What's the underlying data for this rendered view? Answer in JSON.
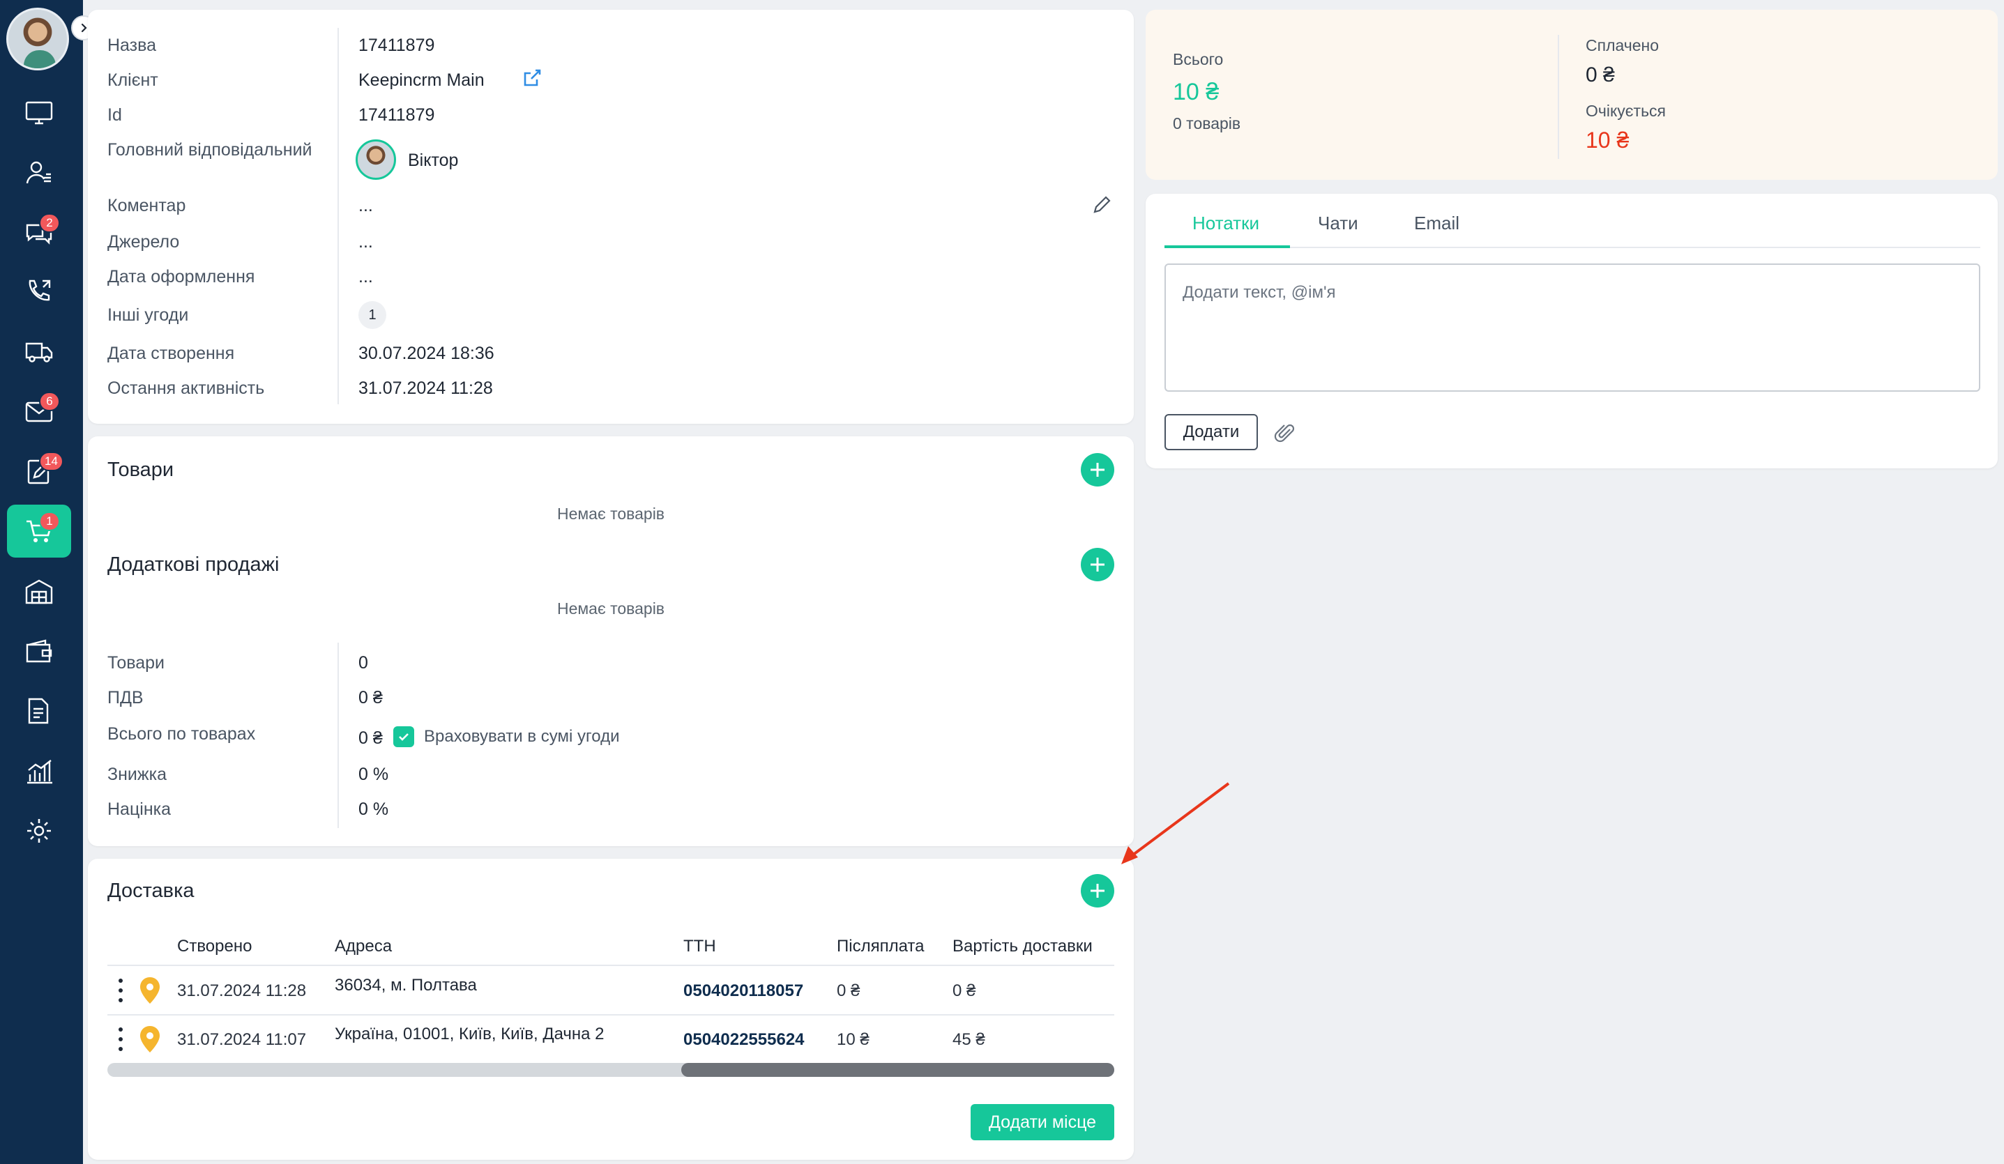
{
  "sidebar": {
    "badges": {
      "chats": "2",
      "mail": "6",
      "tasks": "14",
      "orders": "1"
    }
  },
  "info": {
    "rows": [
      {
        "label": "Назва",
        "value": "17411879"
      },
      {
        "label": "Клієнт",
        "value": "Keepincrm Main"
      },
      {
        "label": "Id",
        "value": "17411879"
      },
      {
        "label": "Головний відповідальний",
        "value": "Віктор"
      },
      {
        "label": "Коментар",
        "value": "..."
      },
      {
        "label": "Джерело",
        "value": "..."
      },
      {
        "label": "Дата оформлення",
        "value": "..."
      },
      {
        "label": "Інші угоди",
        "value": "1"
      },
      {
        "label": "Дата створення",
        "value": "30.07.2024 18:36"
      },
      {
        "label": "Остання активність",
        "value": "31.07.2024 11:28"
      }
    ]
  },
  "goods": {
    "title": "Товари",
    "empty": "Немає товарів",
    "extra_title": "Додаткові продажі",
    "extra_empty": "Немає товарів",
    "totals": [
      {
        "label": "Товари",
        "value": "0"
      },
      {
        "label": "ПДВ",
        "value": "0 ₴"
      },
      {
        "label": "Всього по товарах",
        "value": "0 ₴"
      },
      {
        "label": "Знижка",
        "value": "0 %"
      },
      {
        "label": "Націнка",
        "value": "0 %"
      }
    ],
    "include_label": "Враховувати в сумі угоди"
  },
  "delivery": {
    "title": "Доставка",
    "headers": [
      "Створено",
      "Адреса",
      "ТТН",
      "Післяплата",
      "Вартість доставки"
    ],
    "rows": [
      {
        "created": "31.07.2024 11:28",
        "address": "36034, м. Полтава",
        "ttn": "0504020118057",
        "cod": "0 ₴",
        "cost": "0 ₴"
      },
      {
        "created": "31.07.2024 11:07",
        "address": "Україна, 01001, Київ, Київ, Дачна 2",
        "ttn": "0504022555624",
        "cod": "10 ₴",
        "cost": "45 ₴"
      }
    ],
    "add_place": "Додати місце",
    "scroll_position": 0.57
  },
  "summary": {
    "total_label": "Всього",
    "total_value": "10 ₴",
    "items_count": "0 товарів",
    "paid_label": "Сплачено",
    "paid_value": "0 ₴",
    "expected_label": "Очікується",
    "expected_value": "10 ₴"
  },
  "notes": {
    "tabs": [
      "Нотатки",
      "Чати",
      "Email"
    ],
    "placeholder": "Додати текст, @ім'я",
    "add_label": "Додати"
  },
  "colors": {
    "accent": "#16c79a",
    "sidebar": "#0f2d4e",
    "danger": "#e8361b"
  }
}
